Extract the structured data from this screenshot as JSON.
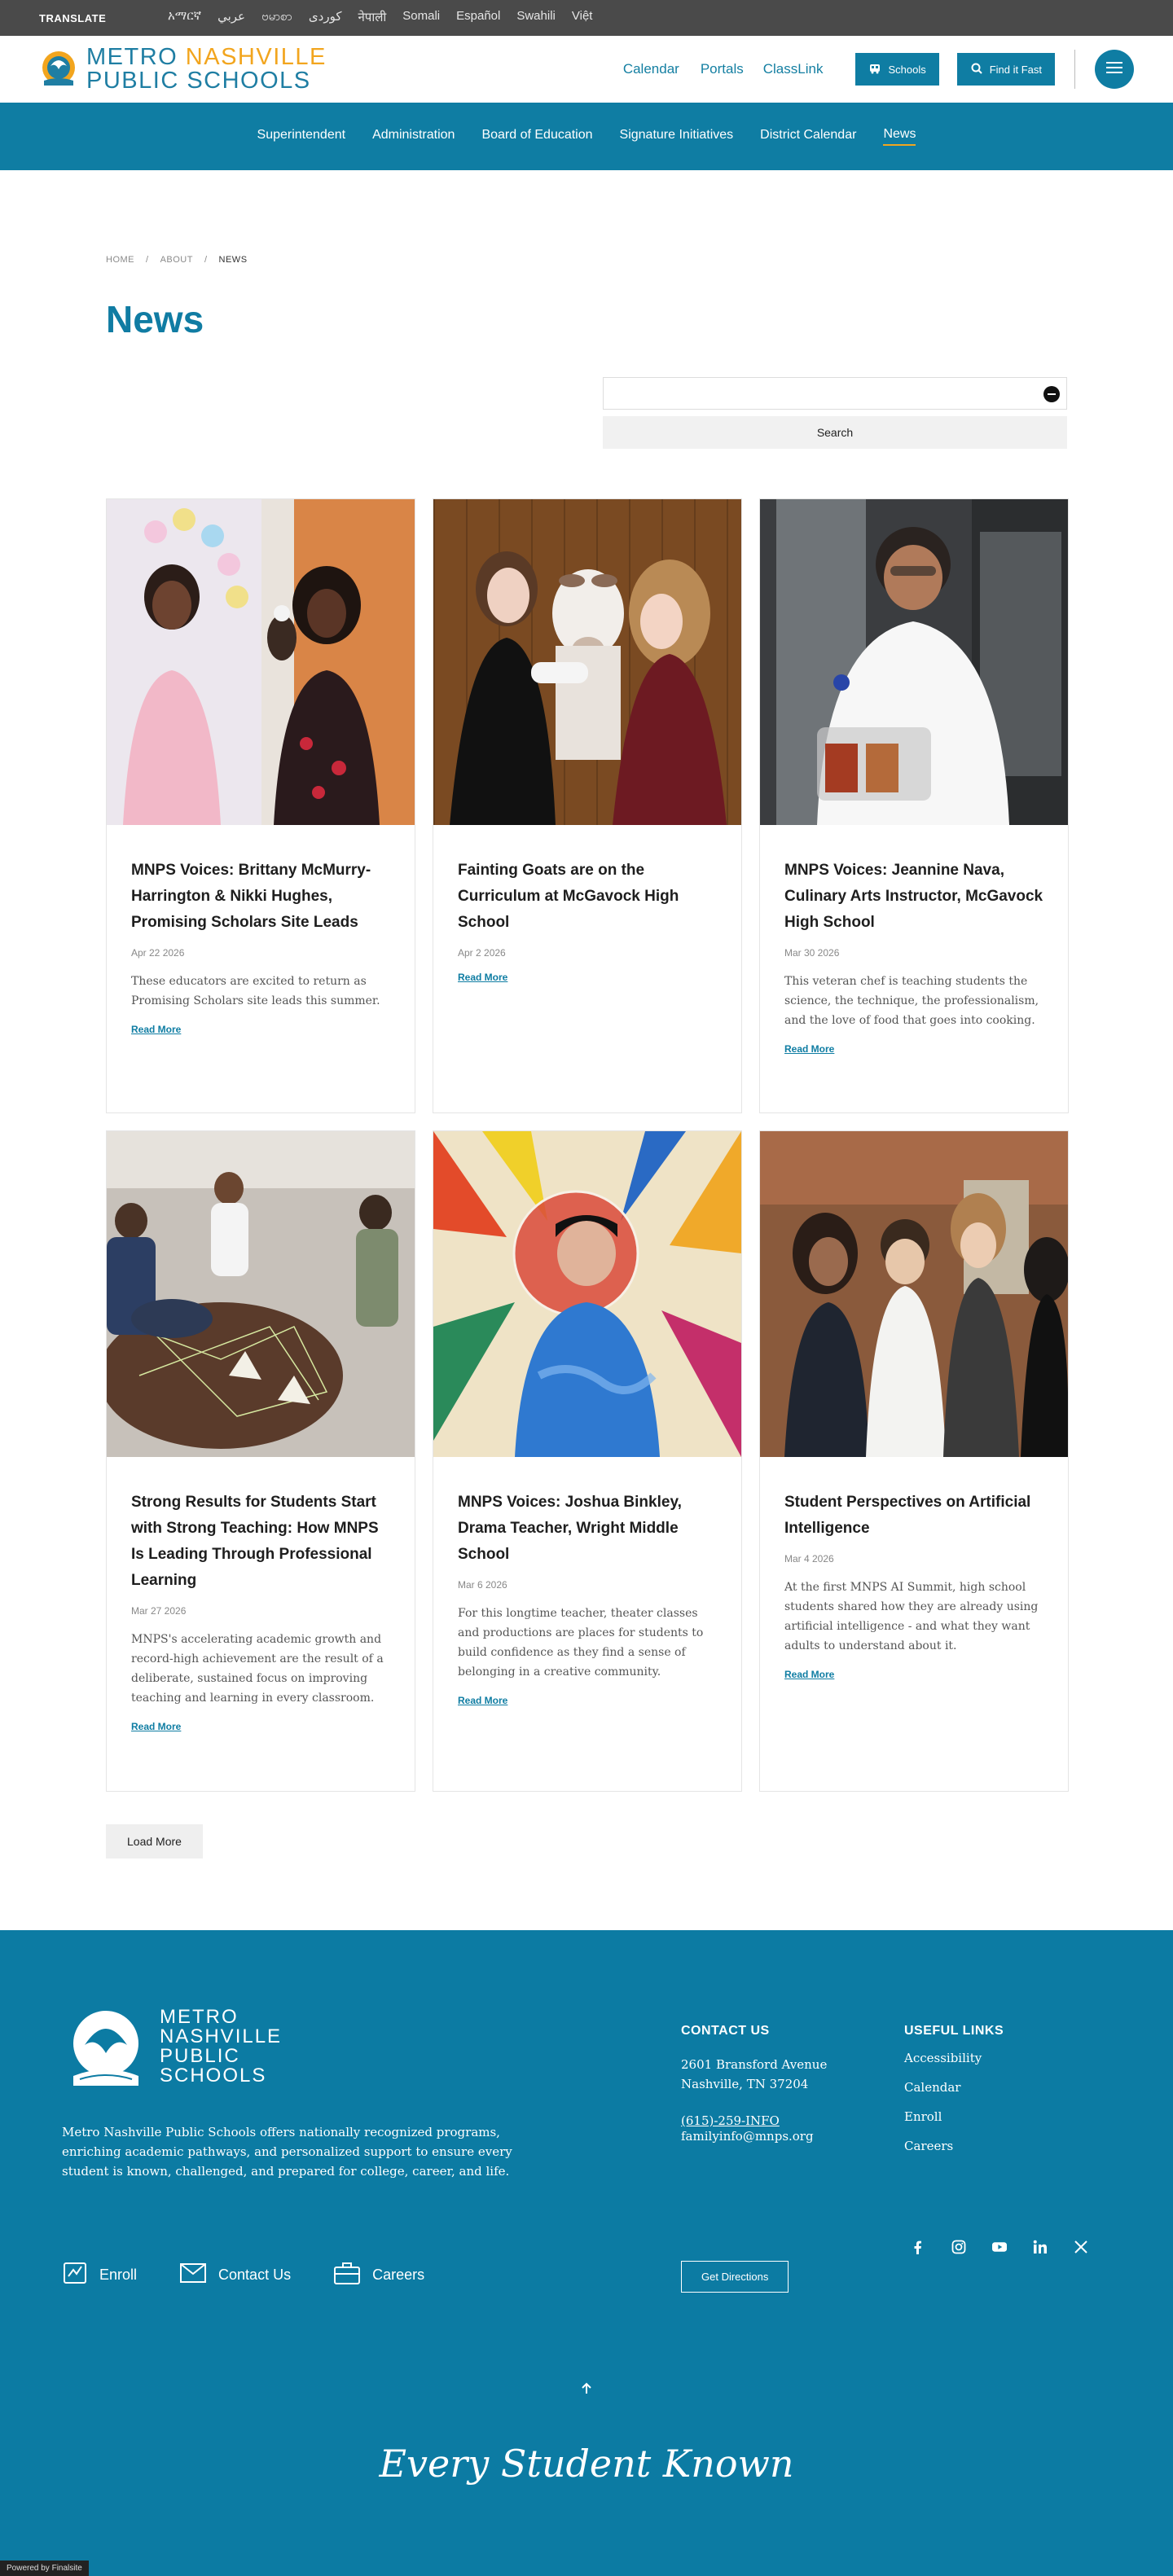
{
  "translate": {
    "label": "TRANSLATE",
    "languages": [
      "አማርኛ",
      "عربي",
      "ဗမာစာ",
      "كوردى",
      "नेपाली",
      "Somali",
      "Español",
      "Swahili",
      "Việt"
    ]
  },
  "header": {
    "logo_line1_a": "METRO",
    "logo_line1_b": "NASHVILLE",
    "logo_line2": "PUBLIC SCHOOLS",
    "links": [
      "Calendar",
      "Portals",
      "ClassLink"
    ],
    "schools_button": "Schools",
    "find_button": "Find it Fast"
  },
  "nav": {
    "items": [
      "Superintendent",
      "Administration",
      "Board of Education",
      "Signature Initiatives",
      "District Calendar",
      "News"
    ],
    "active": "News"
  },
  "breadcrumb": [
    "HOME",
    "ABOUT",
    "NEWS"
  ],
  "page_title": "News",
  "search": {
    "button": "Search",
    "placeholder": ""
  },
  "cards": [
    {
      "title": "MNPS Voices: Brittany McMurry-Harrington & Nikki Hughes, Promising Scholars Site Leads",
      "date": "Apr 22 2026",
      "desc": "These educators are excited to return as Promising Scholars site leads this summer.",
      "link": "Read More"
    },
    {
      "title": "Fainting Goats are on the Curriculum at McGavock High School",
      "date": "Apr 2 2026",
      "desc": "",
      "link": "Read More"
    },
    {
      "title": "MNPS Voices: Jeannine Nava, Culinary Arts Instructor, McGavock High School",
      "date": "Mar 30 2026",
      "desc": "This veteran chef is teaching students the science, the technique, the professionalism, and the love of food that goes into cooking.",
      "link": "Read More"
    },
    {
      "title": "Strong Results for Students Start with Strong Teaching: How MNPS Is Leading Through Professional Learning",
      "date": "Mar 27 2026",
      "desc": "MNPS's accelerating academic growth and record-high achievement are the result of a deliberate, sustained focus on improving teaching and learning in every classroom.",
      "link": "Read More"
    },
    {
      "title": "MNPS Voices: Joshua Binkley, Drama Teacher, Wright Middle School",
      "date": "Mar 6 2026",
      "desc": "For this longtime teacher, theater classes and productions are places for students to build confidence as they find a sense of belonging in a creative community.",
      "link": "Read More"
    },
    {
      "title": "Student Perspectives on Artificial Intelligence",
      "date": "Mar 4 2026",
      "desc": "At the first MNPS AI Summit, high school students shared how they are already using artificial intelligence - and what they want adults to understand about it.",
      "link": "Read More"
    }
  ],
  "load_more": "Load More",
  "footer": {
    "logo_lines": [
      "METRO",
      "NASHVILLE",
      "PUBLIC",
      "SCHOOLS"
    ],
    "about": "Metro Nashville Public Schools offers nationally recognized programs, enriching academic pathways, and personalized support to ensure every student is known, challenged, and prepared for college, career, and life.",
    "actions": [
      "Enroll",
      "Contact Us",
      "Careers"
    ],
    "contact_heading": "CONTACT US",
    "address1": "2601 Bransford Avenue",
    "address2": "Nashville, TN  37204",
    "phone": "(615)-259-INFO",
    "email": "familyinfo@mnps.org",
    "directions": "Get Directions",
    "links_heading": "USEFUL LINKS",
    "links": [
      "Accessibility",
      "Calendar",
      "Enroll",
      "Careers"
    ],
    "tagline": "Every Student Known",
    "powered": "Powered by Finalsite"
  }
}
